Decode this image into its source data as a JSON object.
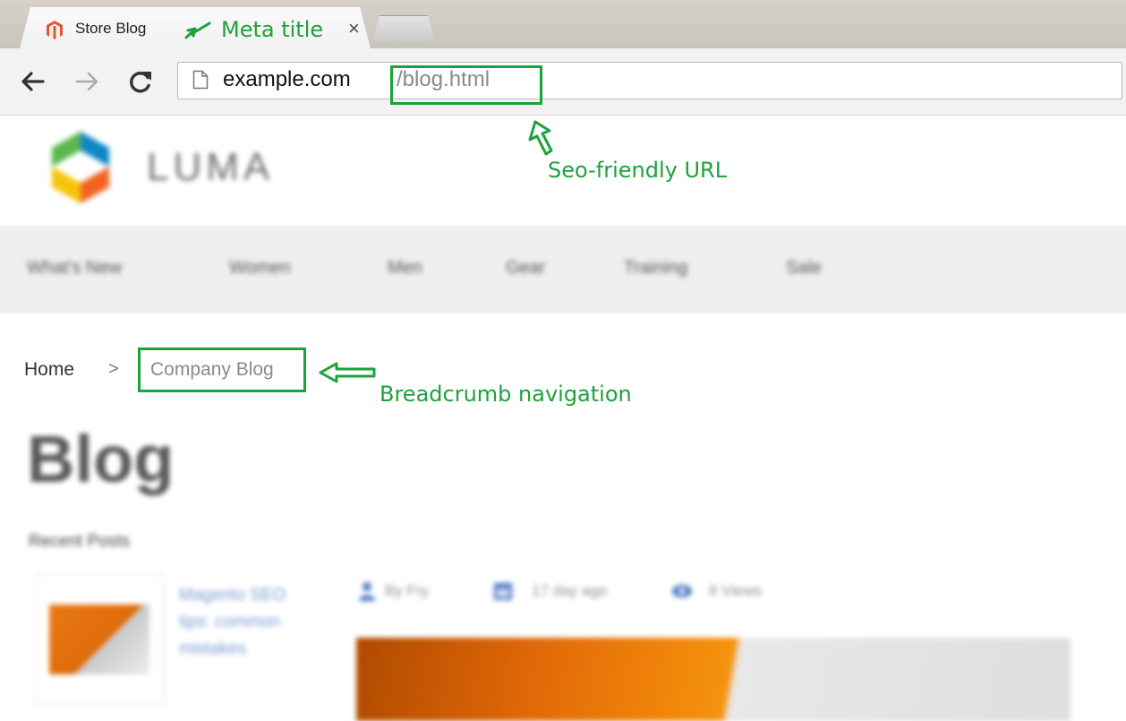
{
  "browser": {
    "tab_title": "Store Blog",
    "tab_close": "×",
    "url_host": "example.com",
    "url_path": "/blog.html"
  },
  "site": {
    "logo_text": "LUMA",
    "nav": [
      "What's New",
      "Women",
      "Men",
      "Gear",
      "Training",
      "Sale"
    ]
  },
  "breadcrumb": {
    "home": "Home",
    "separator": ">",
    "current": "Company Blog"
  },
  "page": {
    "heading": "Blog",
    "recent_posts_title": "Recent Posts",
    "recent_post_link": "Magento SEO tips: common mistakes",
    "post_author": "By Fry",
    "post_date": "17 day ago",
    "post_views": "8 Views"
  },
  "annotations": {
    "meta_title": "Meta title",
    "seo_url": "Seo-friendly URL",
    "breadcrumb_nav": "Breadcrumb navigation"
  },
  "colors": {
    "annotation": "#1ea23b",
    "magento_favicon": "#e4572e",
    "link": "#7a9ad0",
    "hero_orange": "#f1870a"
  }
}
